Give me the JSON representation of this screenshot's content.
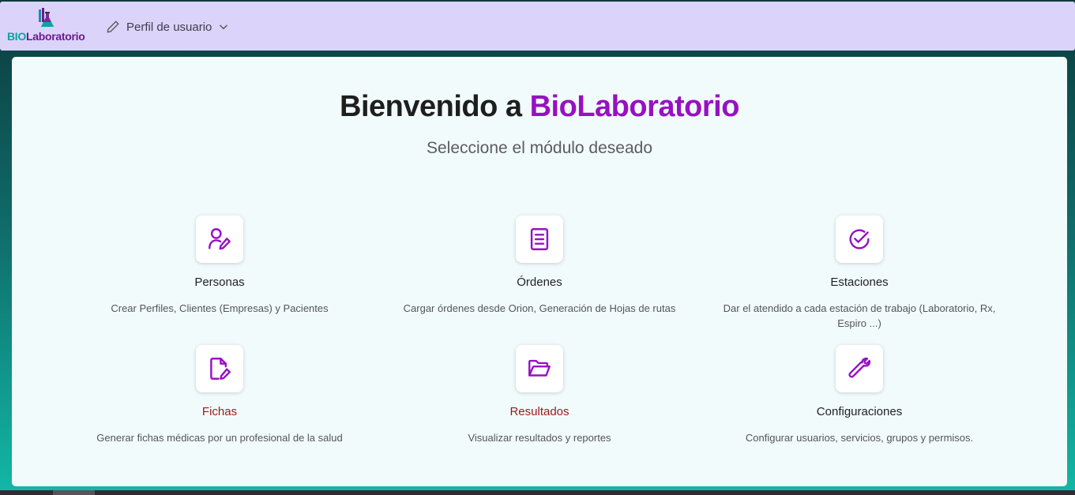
{
  "header": {
    "logo_bio": "BIO",
    "logo_lab": "Laboratorio",
    "profile_label": "Perfil de usuario"
  },
  "main": {
    "title_prefix": "Bienvenido a ",
    "title_brand": "BioLaboratorio",
    "subtitle": "Seleccione el módulo deseado"
  },
  "modules": [
    {
      "name": "Personas",
      "description": "Crear Perfiles, Clientes (Empresas) y Pacientes",
      "icon": "user-edit-icon"
    },
    {
      "name": "Órdenes",
      "description": "Cargar órdenes desde Orion, Generación de Hojas de rutas",
      "icon": "document-list-icon"
    },
    {
      "name": "Estaciones",
      "description": "Dar el atendido a cada estación de trabajo (Laboratorio, Rx, Espiro ...)",
      "icon": "check-circle-icon"
    },
    {
      "name": "Fichas",
      "description": "Generar fichas médicas por un profesional de la salud",
      "icon": "file-edit-icon"
    },
    {
      "name": "Resultados",
      "description": "Visualizar resultados y reportes",
      "icon": "folder-open-icon"
    },
    {
      "name": "Configuraciones",
      "description": "Configurar usuarios, servicios, grupos y permisos.",
      "icon": "wrench-icon"
    }
  ],
  "colors": {
    "header_bg": "#dcd3fb",
    "accent": "#9711c2",
    "card_bg": "#f1fbfc",
    "alert_name": "#9a1a1a"
  }
}
